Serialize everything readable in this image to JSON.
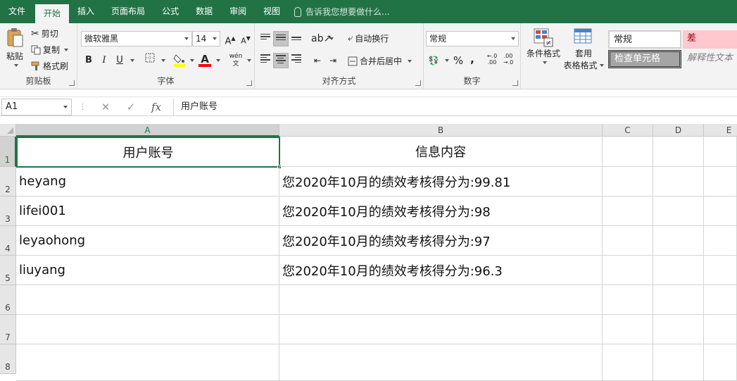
{
  "tabs": [
    {
      "label": "文件",
      "active": false
    },
    {
      "label": "开始",
      "active": true
    },
    {
      "label": "插入",
      "active": false
    },
    {
      "label": "页面布局",
      "active": false
    },
    {
      "label": "公式",
      "active": false
    },
    {
      "label": "数据",
      "active": false
    },
    {
      "label": "审阅",
      "active": false
    },
    {
      "label": "视图",
      "active": false
    }
  ],
  "tell_me": "告诉我您想要做什么...",
  "ribbon": {
    "clipboard": {
      "paste": "粘贴",
      "cut": "剪切",
      "copy": "复制",
      "format_painter": "格式刷",
      "label": "剪贴板"
    },
    "font": {
      "font_name": "微软雅黑",
      "font_size": "14",
      "bold": "B",
      "italic": "I",
      "underline": "U",
      "font_color_glyph": "A",
      "phonetic": "wén",
      "label": "字体"
    },
    "alignment": {
      "wrap_text": "自动换行",
      "merge_center": "合并后居中",
      "label": "对齐方式"
    },
    "number": {
      "format": "常规",
      "percent": "%",
      "comma": ",",
      "label": "数字"
    },
    "styles": {
      "conditional": "条件格式",
      "table_line1": "套用",
      "table_line2": "表格格式",
      "normal": "常规",
      "bad": "差",
      "check_cell": "检查单元格",
      "explanatory": "解释性文本"
    }
  },
  "namebox": "A1",
  "formula": "用户账号",
  "columns": [
    "A",
    "B",
    "C",
    "D",
    "E"
  ],
  "rows": [
    "1",
    "2",
    "3",
    "4",
    "5",
    "6",
    "7",
    "8"
  ],
  "cells": {
    "A1": "用户账号",
    "B1": "信息内容",
    "A2": "heyang",
    "B2": "您2020年10月的绩效考核得分为:99.81",
    "A3": "lifei001",
    "B3": "您2020年10月的绩效考核得分为:98",
    "A4": "leyaohong",
    "B4": "您2020年10月的绩效考核得分为:97",
    "A5": "liuyang",
    "B5": "您2020年10月的绩效考核得分为:96.3"
  },
  "colors": {
    "accent": "#217346",
    "bad_bg": "#ffc7ce",
    "bad_text": "#9c0006",
    "check_bg": "#a5a5a5"
  }
}
